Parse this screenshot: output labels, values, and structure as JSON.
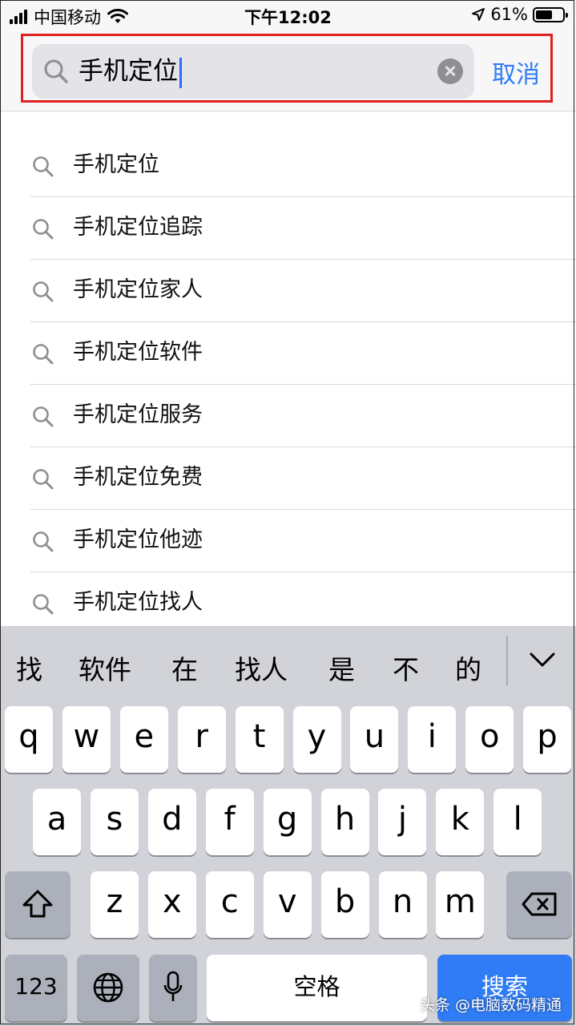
{
  "status_bar": {
    "carrier": "中国移动",
    "time": "下午12:02",
    "battery_percent": "61%",
    "battery_level": 0.61
  },
  "search": {
    "query": "手机定位",
    "cancel_label": "取消"
  },
  "suggestions": [
    "手机定位",
    "手机定位追踪",
    "手机定位家人",
    "手机定位软件",
    "手机定位服务",
    "手机定位免费",
    "手机定位他迹",
    "手机定位找人"
  ],
  "keyboard": {
    "candidates": [
      "找",
      "软件",
      "在",
      "找人",
      "是",
      "不",
      "的"
    ],
    "row1": [
      "q",
      "w",
      "e",
      "r",
      "t",
      "y",
      "u",
      "i",
      "o",
      "p"
    ],
    "row2": [
      "a",
      "s",
      "d",
      "f",
      "g",
      "h",
      "j",
      "k",
      "l"
    ],
    "row3": [
      "z",
      "x",
      "c",
      "v",
      "b",
      "n",
      "m"
    ],
    "numbers_label": "123",
    "space_label": "空格",
    "search_label": "搜索"
  },
  "watermark": "头条 @电脑数码精通"
}
